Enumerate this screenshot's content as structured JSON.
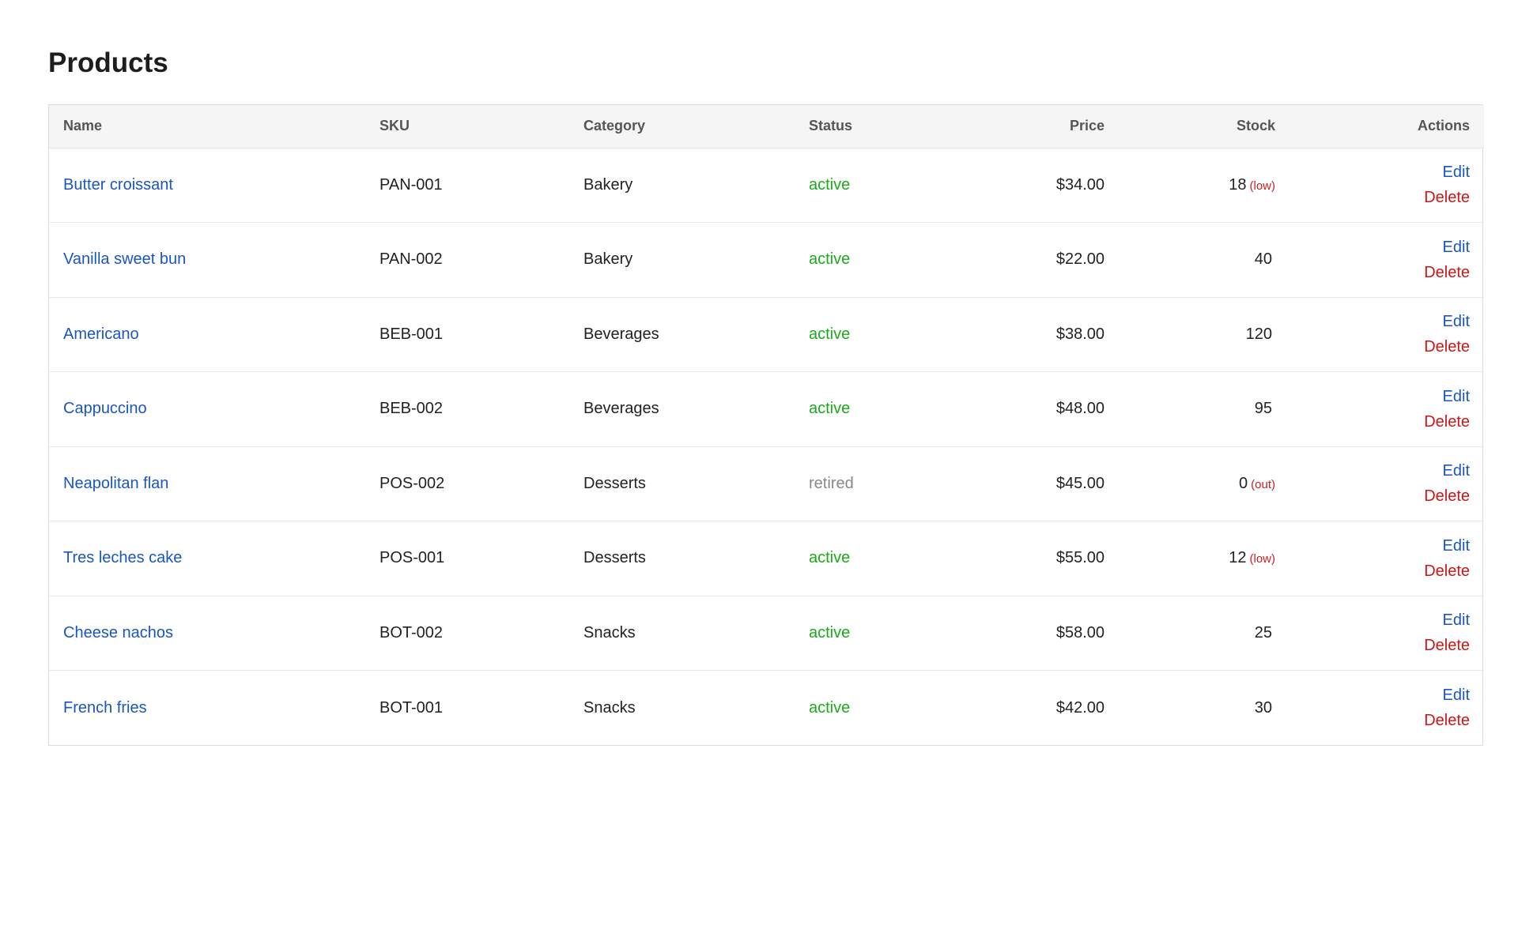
{
  "page": {
    "title": "Products"
  },
  "colors": {
    "link": "#1a55c4",
    "active": "#1aaa1a",
    "retired": "#888888",
    "danger": "#cc1515",
    "header_bg": "#f5f5f5"
  },
  "table": {
    "headers": {
      "name": "Name",
      "sku": "SKU",
      "category": "Category",
      "status": "Status",
      "price": "Price",
      "stock": "Stock",
      "actions": "Actions"
    },
    "rows": [
      {
        "name": "Butter croissant",
        "sku": "PAN-001",
        "category": "Bakery",
        "status": "active",
        "price": "$34.00",
        "stock": "18",
        "stock_flag": "(low)",
        "edit": "Edit",
        "delete": "Delete"
      },
      {
        "name": "Vanilla sweet bun",
        "sku": "PAN-002",
        "category": "Bakery",
        "status": "active",
        "price": "$22.00",
        "stock": "40",
        "stock_flag": "",
        "edit": "Edit",
        "delete": "Delete"
      },
      {
        "name": "Americano",
        "sku": "BEB-001",
        "category": "Beverages",
        "status": "active",
        "price": "$38.00",
        "stock": "120",
        "stock_flag": "",
        "edit": "Edit",
        "delete": "Delete"
      },
      {
        "name": "Cappuccino",
        "sku": "BEB-002",
        "category": "Beverages",
        "status": "active",
        "price": "$48.00",
        "stock": "95",
        "stock_flag": "",
        "edit": "Edit",
        "delete": "Delete"
      },
      {
        "name": "Neapolitan flan",
        "sku": "POS-002",
        "category": "Desserts",
        "status": "retired",
        "price": "$45.00",
        "stock": "0",
        "stock_flag": "(out)",
        "edit": "Edit",
        "delete": "Delete"
      },
      {
        "name": "Tres leches cake",
        "sku": "POS-001",
        "category": "Desserts",
        "status": "active",
        "price": "$55.00",
        "stock": "12",
        "stock_flag": "(low)",
        "edit": "Edit",
        "delete": "Delete"
      },
      {
        "name": "Cheese nachos",
        "sku": "BOT-002",
        "category": "Snacks",
        "status": "active",
        "price": "$58.00",
        "stock": "25",
        "stock_flag": "",
        "edit": "Edit",
        "delete": "Delete"
      },
      {
        "name": "French fries",
        "sku": "BOT-001",
        "category": "Snacks",
        "status": "active",
        "price": "$42.00",
        "stock": "30",
        "stock_flag": "",
        "edit": "Edit",
        "delete": "Delete"
      }
    ]
  }
}
